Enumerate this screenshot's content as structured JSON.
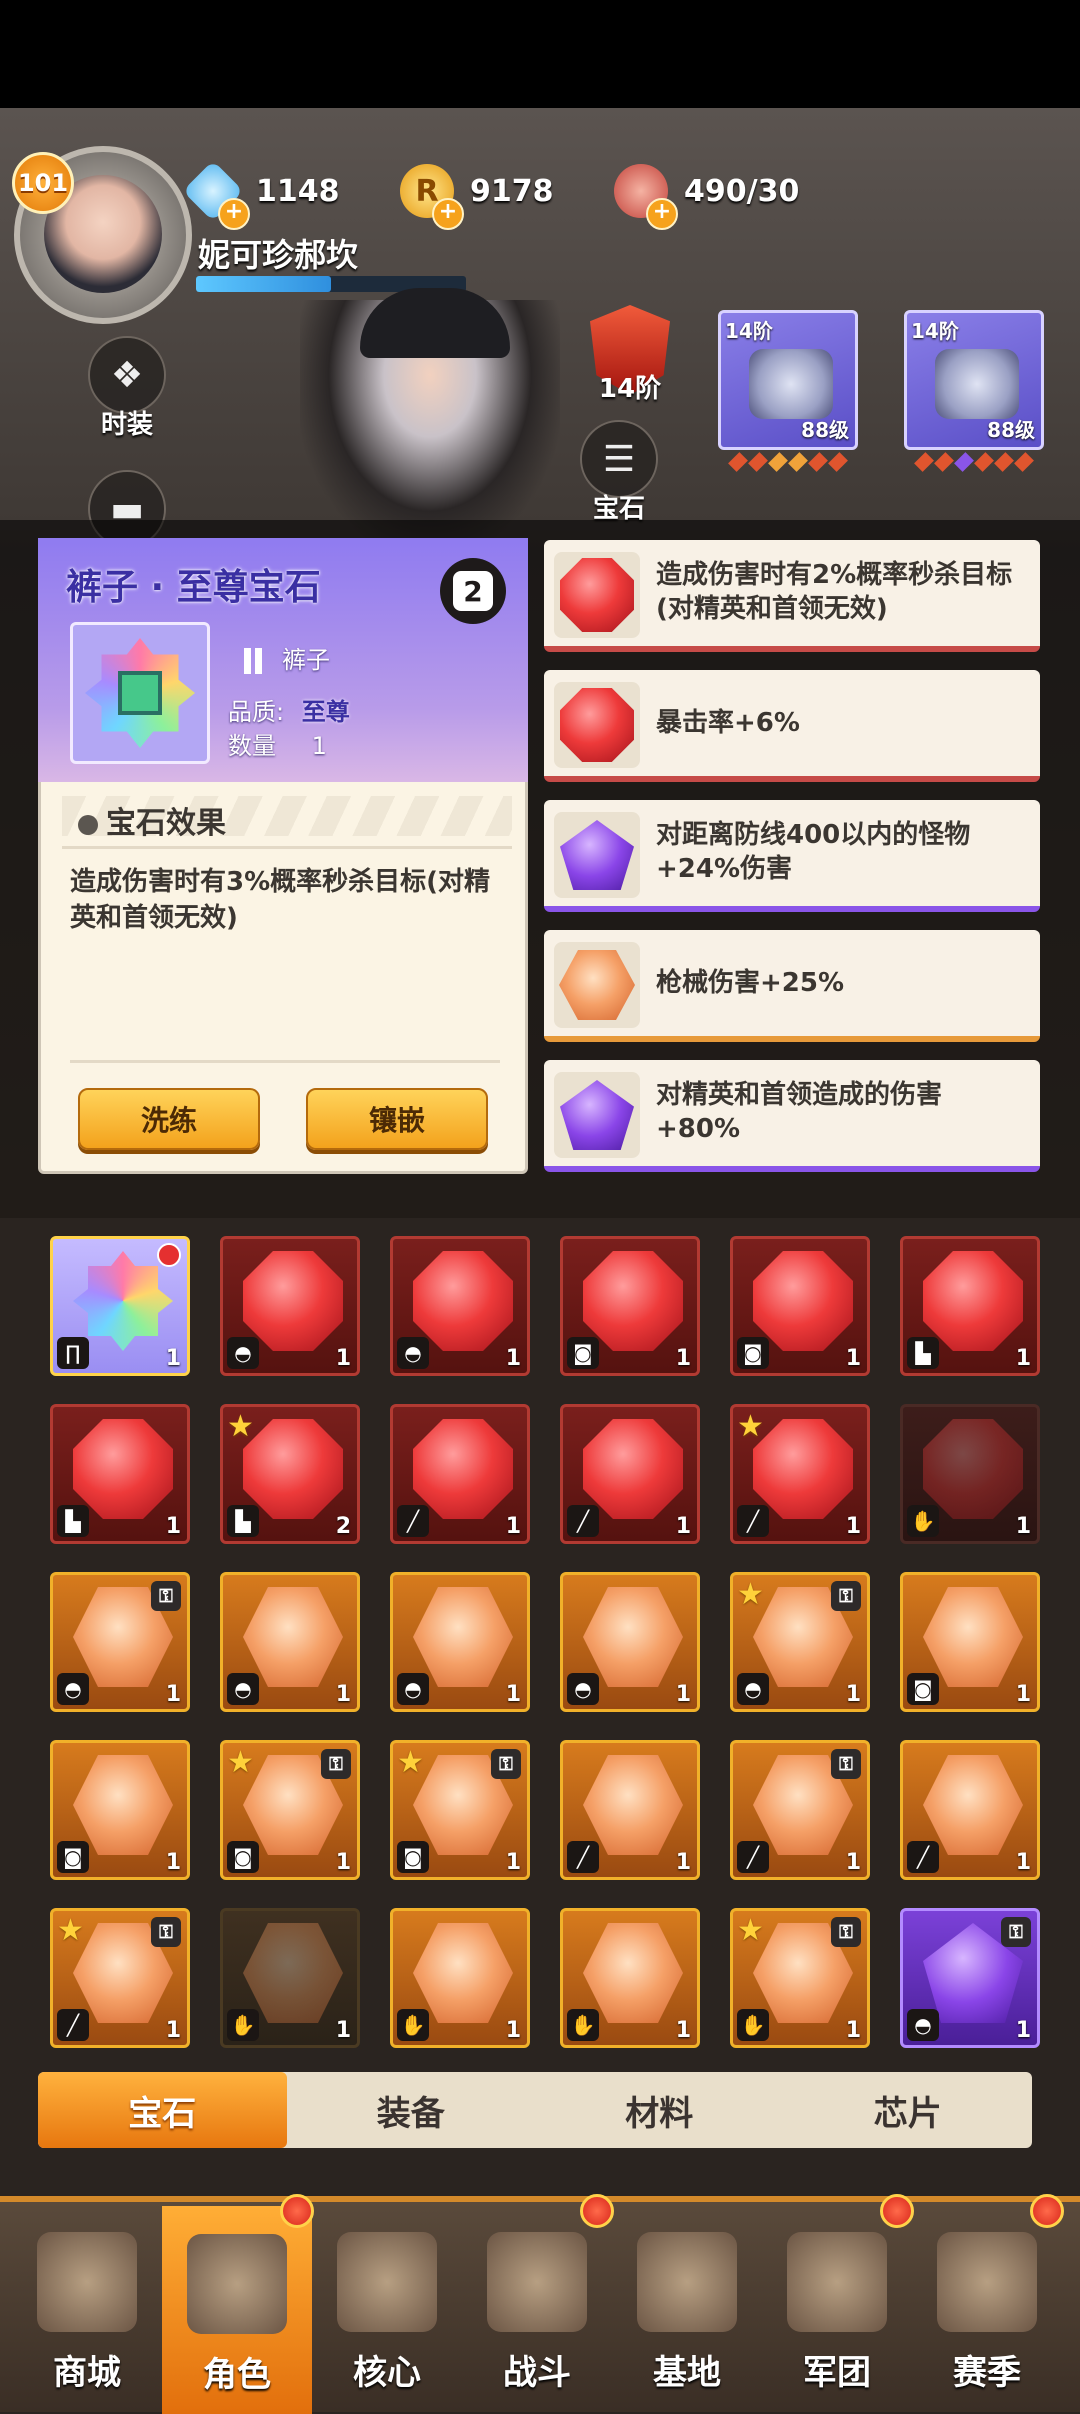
{
  "player": {
    "level": "101",
    "name": "妮可珍郝坎",
    "xp_fraction": 0.5
  },
  "resources": [
    {
      "icon": "diamond-icon",
      "value": "1148",
      "color": "#7fd4ff"
    },
    {
      "icon": "coin-icon",
      "value": "9178",
      "color": "#f6b81f"
    },
    {
      "icon": "meat-icon",
      "value": "490/30",
      "color": "#d95a4a"
    }
  ],
  "side_buttons": {
    "fashion": "时装",
    "gem": "宝石"
  },
  "rank": {
    "label": "14阶"
  },
  "equipment": [
    {
      "stage": "14阶",
      "level": "88级"
    },
    {
      "stage": "14阶",
      "level": "88级"
    }
  ],
  "detail": {
    "title": "裤子 · 至尊宝石",
    "lock_glyph": "2",
    "slot_label": "裤子",
    "quality_label": "品质:",
    "quality_value": "至尊",
    "count_label": "数量",
    "count_value": "1",
    "effect_heading": "宝石效果",
    "effect_text": "造成伤害时有3%概率秒杀目标(对精英和首领无效)",
    "refine_button": "洗练",
    "inlay_button": "镶嵌"
  },
  "candidates": [
    {
      "gem": "red-octagon",
      "text": "造成伤害时有2%概率秒杀目标(对精英和首领无效)"
    },
    {
      "gem": "red-octagon",
      "text": "暴击率+6%"
    },
    {
      "gem": "purple-pentagon",
      "text": "对距离防线400以内的怪物+24%伤害"
    },
    {
      "gem": "orange-hexagon",
      "text": "枪械伤害+25%"
    },
    {
      "gem": "purple-pentagon",
      "text": "对精英和首领造成的伤害+80%"
    }
  ],
  "inventory": [
    {
      "kind": "rainbow",
      "part": "pants-icon",
      "qty": "1",
      "star": false,
      "lock": false,
      "new": true
    },
    {
      "kind": "red",
      "part": "helmet-icon",
      "qty": "1",
      "star": false,
      "lock": false
    },
    {
      "kind": "red",
      "part": "helmet-icon",
      "qty": "1",
      "star": false,
      "lock": false
    },
    {
      "kind": "red",
      "part": "armor-icon",
      "qty": "1",
      "star": false,
      "lock": false
    },
    {
      "kind": "red",
      "part": "armor-icon",
      "qty": "1",
      "star": false,
      "lock": false
    },
    {
      "kind": "red",
      "part": "boots-icon",
      "qty": "1",
      "star": false,
      "lock": false
    },
    {
      "kind": "red",
      "part": "boots-icon",
      "qty": "1",
      "star": false,
      "lock": false
    },
    {
      "kind": "red",
      "part": "boots-icon",
      "qty": "2",
      "star": true,
      "lock": false
    },
    {
      "kind": "red",
      "part": "gun-icon",
      "qty": "1",
      "star": false,
      "lock": false
    },
    {
      "kind": "red",
      "part": "gun-icon",
      "qty": "1",
      "star": false,
      "lock": false
    },
    {
      "kind": "red",
      "part": "gun-icon",
      "qty": "1",
      "star": true,
      "lock": false
    },
    {
      "kind": "red-dim",
      "part": "glove-icon",
      "qty": "1",
      "star": false,
      "lock": false
    },
    {
      "kind": "orange",
      "part": "helmet-icon",
      "qty": "1",
      "star": false,
      "lock": true
    },
    {
      "kind": "orange",
      "part": "helmet-icon",
      "qty": "1",
      "star": false,
      "lock": false
    },
    {
      "kind": "orange",
      "part": "helmet-icon",
      "qty": "1",
      "star": false,
      "lock": false
    },
    {
      "kind": "orange",
      "part": "helmet-icon",
      "qty": "1",
      "star": false,
      "lock": false
    },
    {
      "kind": "orange",
      "part": "helmet-icon",
      "qty": "1",
      "star": true,
      "lock": true
    },
    {
      "kind": "orange",
      "part": "armor-icon",
      "qty": "1",
      "star": false,
      "lock": false
    },
    {
      "kind": "orange",
      "part": "armor-icon",
      "qty": "1",
      "star": false,
      "lock": false
    },
    {
      "kind": "orange",
      "part": "armor-icon",
      "qty": "1",
      "star": true,
      "lock": true
    },
    {
      "kind": "orange",
      "part": "armor-icon",
      "qty": "1",
      "star": true,
      "lock": true
    },
    {
      "kind": "orange",
      "part": "gun-icon",
      "qty": "1",
      "star": false,
      "lock": false
    },
    {
      "kind": "orange",
      "part": "gun-icon",
      "qty": "1",
      "star": false,
      "lock": true
    },
    {
      "kind": "orange",
      "part": "gun-icon",
      "qty": "1",
      "star": false,
      "lock": false
    },
    {
      "kind": "orange",
      "part": "gun-icon",
      "qty": "1",
      "star": true,
      "lock": true
    },
    {
      "kind": "orange-dim",
      "part": "glove-icon",
      "qty": "1",
      "star": false,
      "lock": false
    },
    {
      "kind": "orange",
      "part": "glove-icon",
      "qty": "1",
      "star": false,
      "lock": false
    },
    {
      "kind": "orange",
      "part": "glove-icon",
      "qty": "1",
      "star": false,
      "lock": false
    },
    {
      "kind": "orange",
      "part": "glove-icon",
      "qty": "1",
      "star": true,
      "lock": true
    },
    {
      "kind": "purple",
      "part": "helmet-icon",
      "qty": "1",
      "star": false,
      "lock": true
    }
  ],
  "tabs": [
    "宝石",
    "装备",
    "材料",
    "芯片"
  ],
  "nav": [
    {
      "label": "商城",
      "badge": false
    },
    {
      "label": "角色",
      "badge": true,
      "active": true
    },
    {
      "label": "核心",
      "badge": false
    },
    {
      "label": "战斗",
      "badge": true
    },
    {
      "label": "基地",
      "badge": false
    },
    {
      "label": "军团",
      "badge": true
    },
    {
      "label": "赛季",
      "badge": true
    }
  ]
}
